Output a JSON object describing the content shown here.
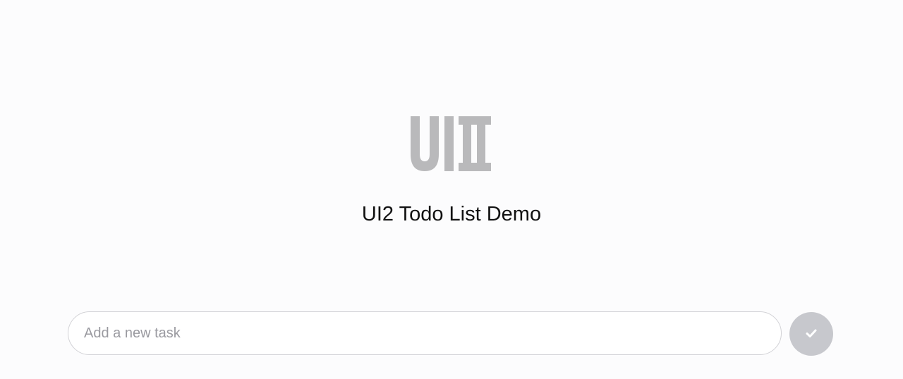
{
  "app": {
    "title": "UI2 Todo List Demo",
    "logo_icon": "ui2-logo"
  },
  "task_form": {
    "input_value": "",
    "input_placeholder": "Add a new task",
    "submit_icon": "check-icon"
  },
  "colors": {
    "background": "#fcfcfd",
    "logo": "#b9b9bb",
    "submit_button": "#c7c8cd",
    "submit_icon": "#ffffff",
    "input_border": "#d2d2d6",
    "placeholder": "#9a9aa0"
  }
}
